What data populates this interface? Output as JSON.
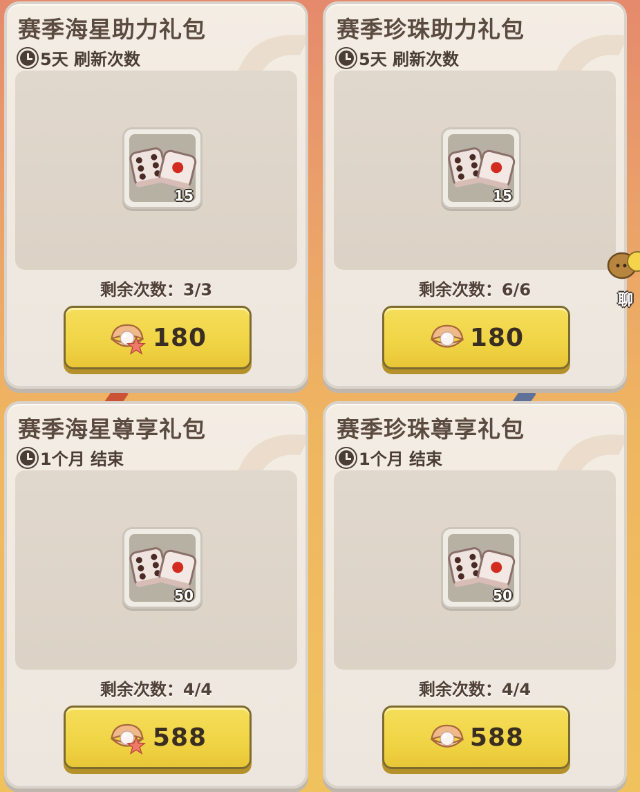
{
  "cards": [
    {
      "title": "赛季海星助力礼包",
      "timer": "5天 刷新次数",
      "item_count": "15",
      "remaining": "剩余次数：3/3",
      "price": "180",
      "currency": "starfish-pearl-icon"
    },
    {
      "title": "赛季珍珠助力礼包",
      "timer": "5天 刷新次数",
      "item_count": "15",
      "remaining": "剩余次数：6/6",
      "price": "180",
      "currency": "pearl-icon"
    },
    {
      "title": "赛季海星尊享礼包",
      "timer": "1个月 结束",
      "item_count": "50",
      "remaining": "剩余次数：4/4",
      "price": "588",
      "currency": "starfish-pearl-icon"
    },
    {
      "title": "赛季珍珠尊享礼包",
      "timer": "1个月 结束",
      "item_count": "50",
      "remaining": "剩余次数：4/4",
      "price": "588",
      "currency": "pearl-icon"
    }
  ],
  "side": {
    "chat_label": "聊"
  },
  "colors": {
    "button": "#f0d445",
    "card": "#ece6de",
    "panel": "#dcd2c6"
  }
}
